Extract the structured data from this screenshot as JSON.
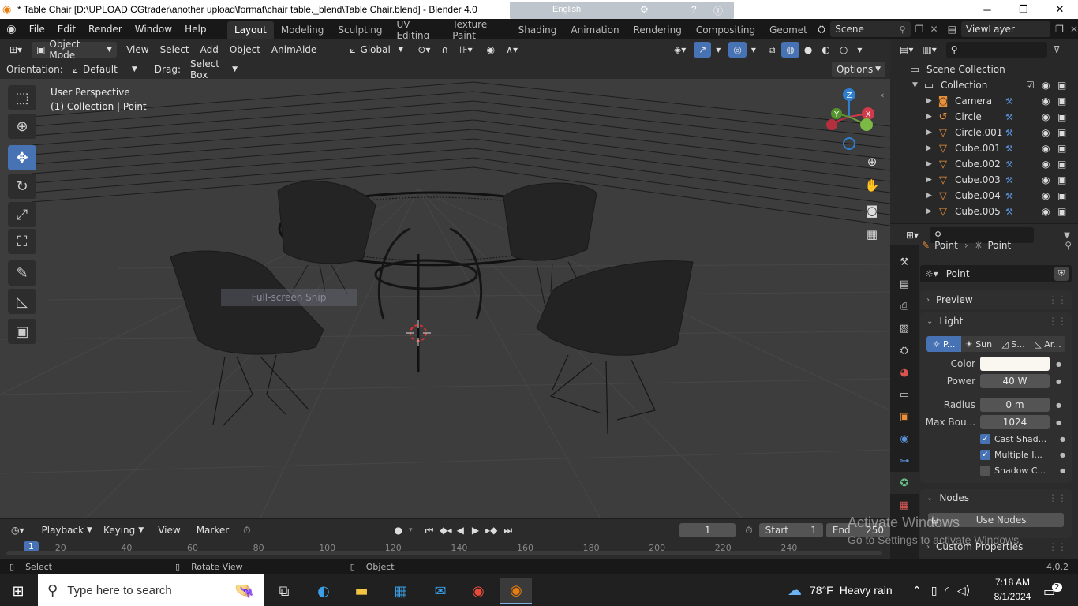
{
  "window": {
    "title": "* Table Chair [D:\\UPLOAD CGtrader\\another upload\\format\\chair table._blend\\Table Chair.blend] - Blender 4.0",
    "ime_label": "English",
    "minimize": "─",
    "maximize": "❐",
    "close": "✕"
  },
  "menubar": {
    "items": [
      "File",
      "Edit",
      "Render",
      "Window",
      "Help"
    ],
    "workspaces": [
      "Layout",
      "Modeling",
      "Sculpting",
      "UV Editing",
      "Texture Paint",
      "Shading",
      "Animation",
      "Rendering",
      "Compositing",
      "Geomet"
    ],
    "active_workspace": "Layout",
    "scene": "Scene",
    "view_layer": "ViewLayer"
  },
  "viewport_header": {
    "mode": "Object Mode",
    "menus": [
      "View",
      "Select",
      "Add",
      "Object",
      "AnimAide"
    ],
    "transform_orientation": "Global",
    "orientation_label": "Orientation:",
    "orientation_value": "Default",
    "drag_label": "Drag:",
    "drag_value": "Select Box",
    "options": "Options"
  },
  "viewport": {
    "perspective": "User Perspective",
    "context": "(1) Collection | Point",
    "snip_overlay": "Full-screen Snip"
  },
  "gizmo": {
    "x": "X",
    "y": "Y",
    "z": "Z"
  },
  "outliner": {
    "scene_collection": "Scene Collection",
    "collection": "Collection",
    "items": [
      {
        "name": "Camera",
        "icon": "camera-icon"
      },
      {
        "name": "Circle",
        "icon": "curve-icon"
      },
      {
        "name": "Circle.001",
        "icon": "mesh-icon"
      },
      {
        "name": "Cube.001",
        "icon": "mesh-icon"
      },
      {
        "name": "Cube.002",
        "icon": "mesh-icon"
      },
      {
        "name": "Cube.003",
        "icon": "mesh-icon"
      },
      {
        "name": "Cube.004",
        "icon": "mesh-icon"
      },
      {
        "name": "Cube.005",
        "icon": "mesh-icon"
      }
    ]
  },
  "properties": {
    "breadcrumb_obj": "Point",
    "breadcrumb_data": "Point",
    "datablock": "Point",
    "preview": "Preview",
    "light_panel": "Light",
    "light_types": [
      "P...",
      "Sun",
      "S...",
      "Ar..."
    ],
    "color_label": "Color",
    "light_color": "#faf6f0",
    "power_label": "Power",
    "power": "40 W",
    "radius_label": "Radius",
    "radius": "0 m",
    "max_bounces_label": "Max Bou...",
    "max_bounces": "1024",
    "cast_shadow": "Cast Shad...",
    "multiple_importance": "Multiple I...",
    "shadow_caustics": "Shadow C...",
    "nodes_panel": "Nodes",
    "use_nodes": "Use Nodes",
    "custom_props": "Custom Properties"
  },
  "timeline": {
    "playback": "Playback",
    "keying": "Keying",
    "view": "View",
    "marker": "Marker",
    "current_frame": "1",
    "start_label": "Start",
    "start": "1",
    "end_label": "End",
    "end": "250",
    "ruler": [
      "1",
      "20",
      "40",
      "60",
      "80",
      "100",
      "120",
      "140",
      "160",
      "180",
      "200",
      "220",
      "240"
    ]
  },
  "statusbar": {
    "select": "Select",
    "rotate_view": "Rotate View",
    "object": "Object",
    "version": "4.0.2"
  },
  "watermark": {
    "line1": "Activate Windows",
    "line2": "Go to Settings to activate Windows."
  },
  "taskbar": {
    "search_placeholder": "Type here to search",
    "weather_temp": "78°F",
    "weather_text": "Heavy rain",
    "time": "7:18 AM",
    "date": "8/1/2024",
    "notifications": "2"
  },
  "colors": {
    "accent": "#4772b3",
    "viewport_bg": "#3d3d3d",
    "object_orange": "#e8903a"
  }
}
